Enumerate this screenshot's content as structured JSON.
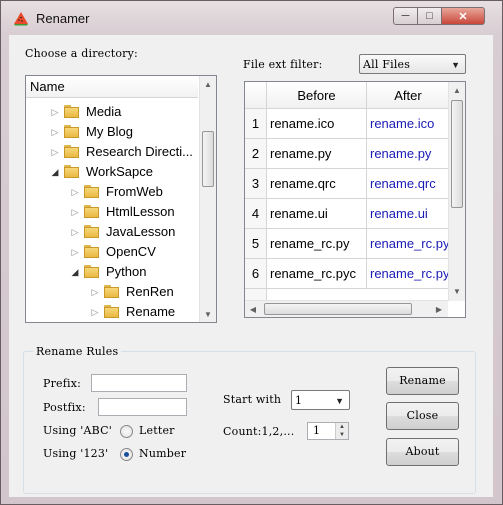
{
  "window": {
    "title": "Renamer"
  },
  "labels": {
    "choose_dir": "Choose a directory:",
    "ext_filter": "File ext filter:",
    "rename_rules": "Rename Rules",
    "prefix": "Prefix:",
    "postfix": "Postfix:",
    "using_abc": "Using 'ABC'",
    "using_123": "Using '123'",
    "start_with": "Start with",
    "count": "Count:1,2,..."
  },
  "tree": {
    "header": "Name",
    "items": [
      {
        "label": "Media",
        "depth": 1,
        "arrow": "collapsed"
      },
      {
        "label": "My Blog",
        "depth": 1,
        "arrow": "collapsed"
      },
      {
        "label": "Research Directi...",
        "depth": 1,
        "arrow": "collapsed"
      },
      {
        "label": "WorkSapce",
        "depth": 1,
        "arrow": "expanded"
      },
      {
        "label": "FromWeb",
        "depth": 2,
        "arrow": "collapsed"
      },
      {
        "label": "HtmlLesson",
        "depth": 2,
        "arrow": "collapsed"
      },
      {
        "label": "JavaLesson",
        "depth": 2,
        "arrow": "collapsed"
      },
      {
        "label": "OpenCV",
        "depth": 2,
        "arrow": "collapsed"
      },
      {
        "label": "Python",
        "depth": 2,
        "arrow": "expanded"
      },
      {
        "label": "RenRen",
        "depth": 3,
        "arrow": "collapsed"
      },
      {
        "label": "Rename",
        "depth": 3,
        "arrow": "collapsed"
      }
    ]
  },
  "filter": {
    "selected": "All Files"
  },
  "table": {
    "columns": [
      "Before",
      "After"
    ],
    "rows": [
      {
        "num": "1",
        "before": "rename.ico",
        "after": "rename.ico"
      },
      {
        "num": "2",
        "before": "rename.py",
        "after": "rename.py"
      },
      {
        "num": "3",
        "before": "rename.qrc",
        "after": "rename.qrc"
      },
      {
        "num": "4",
        "before": "rename.ui",
        "after": "rename.ui"
      },
      {
        "num": "5",
        "before": "rename_rc.py",
        "after": "rename_rc.py"
      },
      {
        "num": "6",
        "before": "rename_rc.pyc",
        "after": "rename_rc.pyc"
      }
    ]
  },
  "rules": {
    "prefix_value": "",
    "postfix_value": "",
    "letter_label": "Letter",
    "number_label": "Number",
    "selected_mode": "Number",
    "start_with_value": "1",
    "count_value": "1"
  },
  "buttons": {
    "rename": "Rename",
    "close": "Close",
    "about": "About"
  },
  "icons": {
    "app": "watermelon-icon",
    "folder": "folder-icon"
  },
  "colors": {
    "after_text": "#1a1ab4",
    "folder": "#e9b842"
  }
}
